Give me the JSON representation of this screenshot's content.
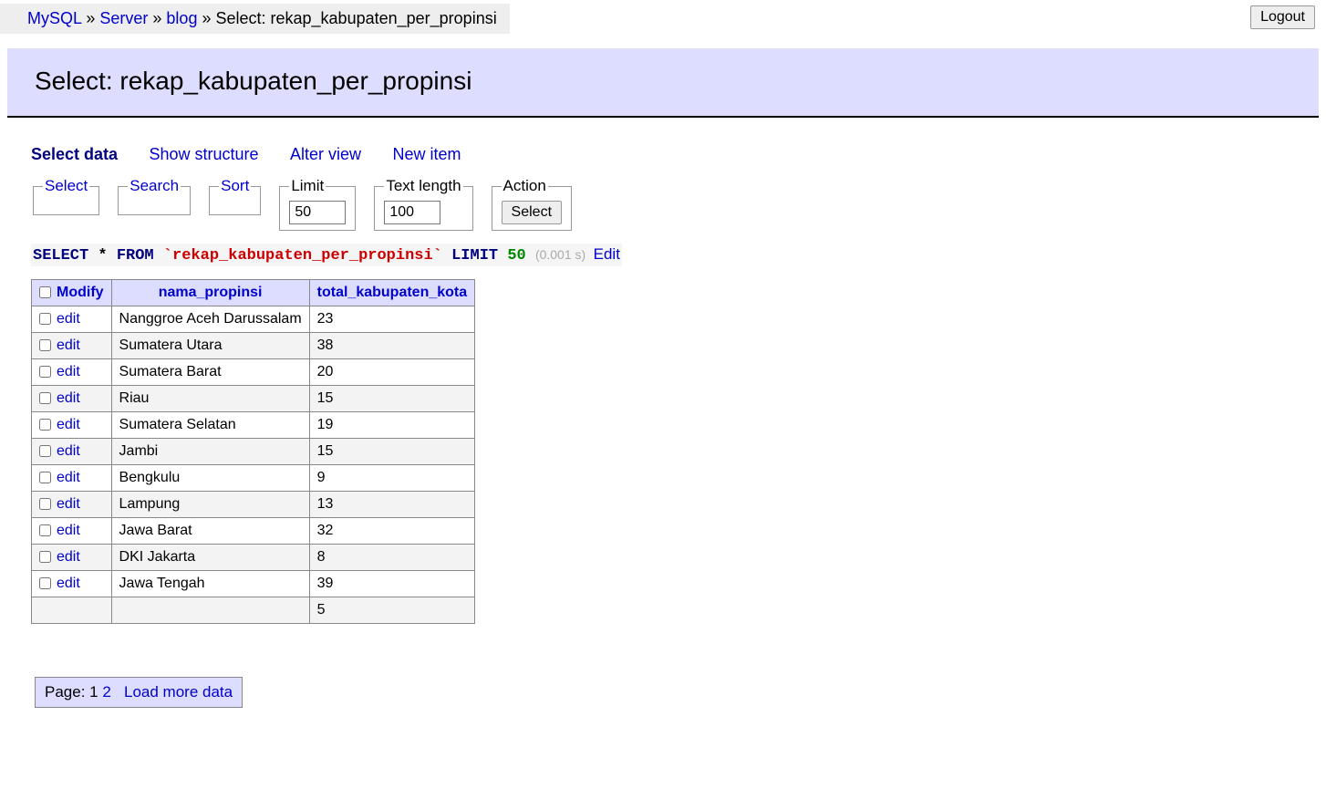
{
  "breadcrumb": {
    "p0": "MySQL",
    "p1": "Server",
    "p2": "blog",
    "p3": "Select: rekap_kabupaten_per_propinsi"
  },
  "logout_label": "Logout",
  "page_title": "Select: rekap_kabupaten_per_propinsi",
  "tabs": {
    "select_data": "Select data",
    "show_structure": "Show structure",
    "alter_view": "Alter view",
    "new_item": "New item"
  },
  "fieldsets": {
    "select_label": "Select",
    "search_label": "Search",
    "sort_label": "Sort",
    "limit_label": "Limit",
    "limit_value": "50",
    "textlen_label": "Text length",
    "textlen_value": "100",
    "action_label": "Action",
    "action_button": "Select"
  },
  "query": {
    "kw_select": "SELECT",
    "star": " * ",
    "kw_from": "FROM",
    "table": "`rekap_kabupaten_per_propinsi`",
    "kw_limit": "LIMIT",
    "limit_num": "50",
    "timing": "(0.001 s)",
    "edit": "Edit"
  },
  "table": {
    "modify_header": "Modify",
    "col1": "nama_propinsi",
    "col2": "total_kabupaten_kota",
    "edit_label": "edit",
    "rows": [
      {
        "c1": "Nanggroe Aceh Darussalam",
        "c2": "23"
      },
      {
        "c1": "Sumatera Utara",
        "c2": "38"
      },
      {
        "c1": "Sumatera Barat",
        "c2": "20"
      },
      {
        "c1": "Riau",
        "c2": "15"
      },
      {
        "c1": "Sumatera Selatan",
        "c2": "19"
      },
      {
        "c1": "Jambi",
        "c2": "15"
      },
      {
        "c1": "Bengkulu",
        "c2": "9"
      },
      {
        "c1": "Lampung",
        "c2": "13"
      },
      {
        "c1": "Jawa Barat",
        "c2": "32"
      },
      {
        "c1": "DKI Jakarta",
        "c2": "8"
      },
      {
        "c1": "Jawa Tengah",
        "c2": "39"
      },
      {
        "c1": "",
        "c2": "5"
      }
    ]
  },
  "pagebar": {
    "label": "Page:",
    "p1": "1",
    "p2": "2",
    "load_more": "Load more data"
  }
}
